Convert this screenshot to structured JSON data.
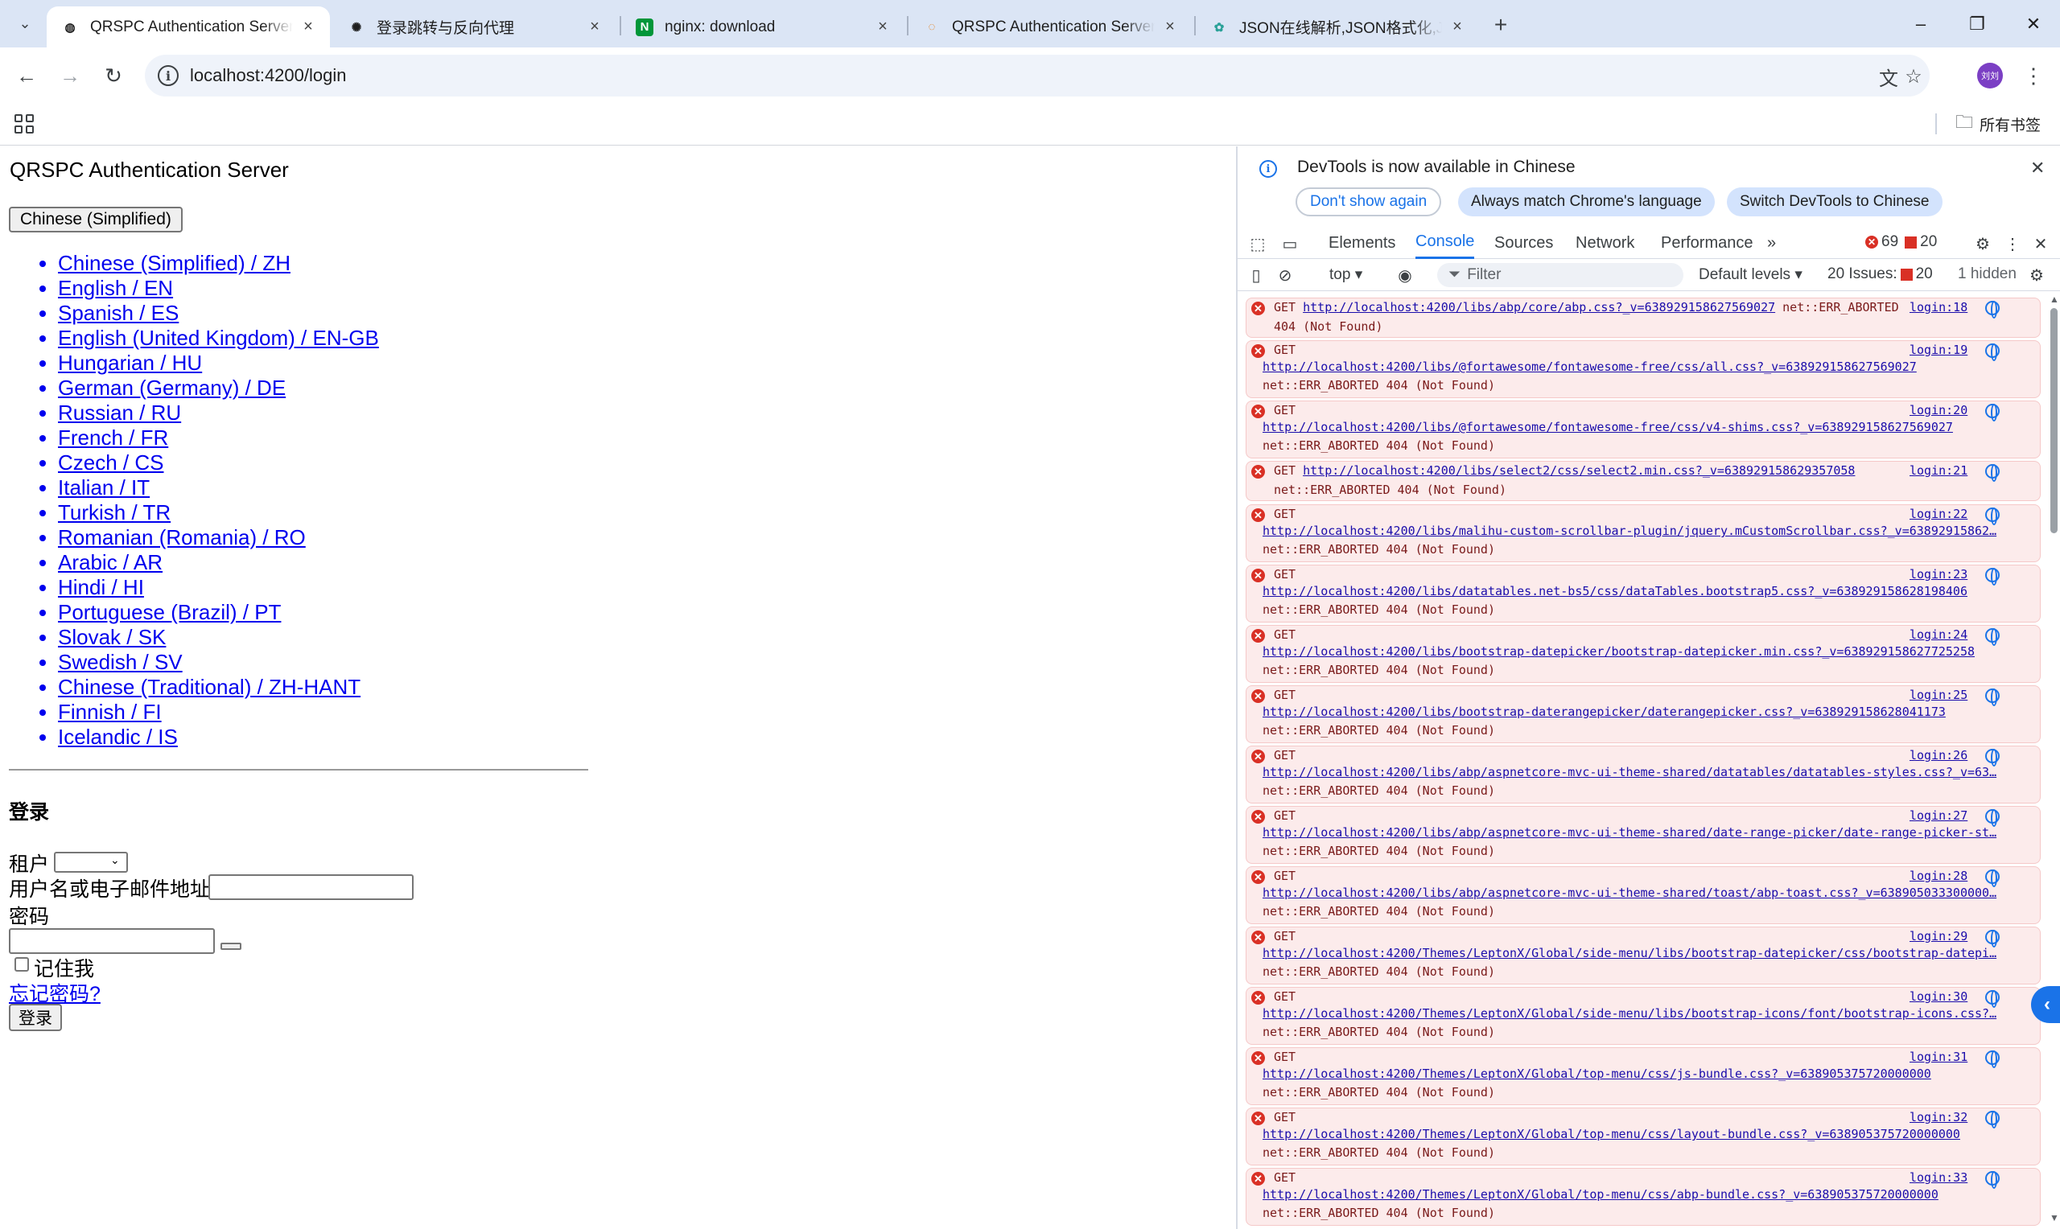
{
  "browser": {
    "tabs": [
      {
        "title": "QRSPC Authentication Server",
        "favicon": "globe-icon",
        "close": "×"
      },
      {
        "title": "登录跳转与反向代理",
        "favicon": "openai-icon",
        "close": "×"
      },
      {
        "title": "nginx: download",
        "favicon": "nginx-icon",
        "close": "×"
      },
      {
        "title": "QRSPC Authentication Server",
        "favicon": "loading-icon",
        "close": "×"
      },
      {
        "title": "JSON在线解析,JSON格式化,JS",
        "favicon": "json-icon",
        "close": "×"
      }
    ],
    "new_tab": "+",
    "window_controls": {
      "minimize": "–",
      "restore": "❐",
      "close": "✕"
    },
    "nav": {
      "back": "←",
      "forward": "→",
      "reload": "↻"
    },
    "url": "localhost:4200/login",
    "avatar_text": "刘刘",
    "bookmarks_all": "所有书签"
  },
  "page": {
    "title": "QRSPC Authentication Server",
    "language_button": "Chinese (Simplified)",
    "languages": [
      "Chinese (Simplified) / ZH",
      "English / EN",
      "Spanish / ES",
      "English (United Kingdom) / EN-GB",
      "Hungarian / HU",
      "German (Germany) / DE",
      "Russian / RU",
      "French / FR",
      "Czech / CS",
      "Italian / IT",
      "Turkish / TR",
      "Romanian (Romania) / RO",
      "Arabic / AR",
      "Hindi / HI",
      "Portuguese (Brazil) / PT",
      "Slovak / SK",
      "Swedish / SV",
      "Chinese (Traditional) / ZH-HANT",
      "Finnish / FI",
      "Icelandic / IS"
    ],
    "login_heading": "登录",
    "tenant_label": "租户",
    "username_label": "用户名或电子邮件地址",
    "password_label": "密码",
    "remember_label": "记住我",
    "forgot_link": "忘记密码?",
    "login_button": "登录"
  },
  "devtools": {
    "banner_text": "DevTools is now available in Chinese",
    "btn_dont_show": "Don't show again",
    "btn_always_match": "Always match Chrome's language",
    "btn_switch": "Switch DevTools to Chinese",
    "tabs": [
      "Elements",
      "Console",
      "Sources",
      "Network",
      "Performance"
    ],
    "more_tabs": "»",
    "error_count": "69",
    "issue_count": "20",
    "context": "top ▾",
    "filter_placeholder": "Filter",
    "levels": "Default levels ▾",
    "issues_label": "20 Issues:",
    "issues_count": "20",
    "hidden_label": "1 hidden",
    "messages": [
      {
        "line1": "GET",
        "url": "http://localhost:4200/libs/abp/core/abp.css?_v=638929158627569027",
        "inline_tail": "net::ERR_ABORTED",
        "line2": "404 (Not Found)",
        "src": "login:18"
      },
      {
        "line1": "GET",
        "url": "http://localhost:4200/libs/@fortawesome/fontawesome-free/css/all.css?_v=638929158627569027",
        "line2": "net::ERR_ABORTED 404 (Not Found)",
        "src": "login:19"
      },
      {
        "line1": "GET",
        "url": "http://localhost:4200/libs/@fortawesome/fontawesome-free/css/v4-shims.css?_v=638929158627569027",
        "line2": "net::ERR_ABORTED 404 (Not Found)",
        "src": "login:20"
      },
      {
        "line1": "GET",
        "url": "http://localhost:4200/libs/select2/css/select2.min.css?_v=638929158629357058",
        "line2": "net::ERR_ABORTED 404 (Not Found)",
        "src": "login:21"
      },
      {
        "line1": "GET",
        "url": "http://localhost:4200/libs/malihu-custom-scrollbar-plugin/jquery.mCustomScrollbar.css?_v=63892915862…",
        "line2": "net::ERR_ABORTED 404 (Not Found)",
        "src": "login:22"
      },
      {
        "line1": "GET",
        "url": "http://localhost:4200/libs/datatables.net-bs5/css/dataTables.bootstrap5.css?_v=638929158628198406",
        "line2": "net::ERR_ABORTED 404 (Not Found)",
        "src": "login:23"
      },
      {
        "line1": "GET",
        "url": "http://localhost:4200/libs/bootstrap-datepicker/bootstrap-datepicker.min.css?_v=638929158627725258",
        "line2": "net::ERR_ABORTED 404 (Not Found)",
        "src": "login:24"
      },
      {
        "line1": "GET",
        "url": "http://localhost:4200/libs/bootstrap-daterangepicker/daterangepicker.css?_v=638929158628041173",
        "line2": "net::ERR_ABORTED 404 (Not Found)",
        "src": "login:25"
      },
      {
        "line1": "GET",
        "url": "http://localhost:4200/libs/abp/aspnetcore-mvc-ui-theme-shared/datatables/datatables-styles.css?_v=63…",
        "line2": "net::ERR_ABORTED 404 (Not Found)",
        "src": "login:26"
      },
      {
        "line1": "GET",
        "url": "http://localhost:4200/libs/abp/aspnetcore-mvc-ui-theme-shared/date-range-picker/date-range-picker-st…",
        "line2": "net::ERR_ABORTED 404 (Not Found)",
        "src": "login:27"
      },
      {
        "line1": "GET",
        "url": "http://localhost:4200/libs/abp/aspnetcore-mvc-ui-theme-shared/toast/abp-toast.css?_v=638905033300000…",
        "line2": "net::ERR_ABORTED 404 (Not Found)",
        "src": "login:28"
      },
      {
        "line1": "GET",
        "url": "http://localhost:4200/Themes/LeptonX/Global/side-menu/libs/bootstrap-datepicker/css/bootstrap-datepi…",
        "line2": "net::ERR_ABORTED 404 (Not Found)",
        "src": "login:29"
      },
      {
        "line1": "GET",
        "url": "http://localhost:4200/Themes/LeptonX/Global/side-menu/libs/bootstrap-icons/font/bootstrap-icons.css?…",
        "line2": "net::ERR_ABORTED 404 (Not Found)",
        "src": "login:30"
      },
      {
        "line1": "GET",
        "url": "http://localhost:4200/Themes/LeptonX/Global/top-menu/css/js-bundle.css?_v=638905375720000000",
        "line2": "net::ERR_ABORTED 404 (Not Found)",
        "src": "login:31"
      },
      {
        "line1": "GET",
        "url": "http://localhost:4200/Themes/LeptonX/Global/top-menu/css/layout-bundle.css?_v=638905375720000000",
        "line2": "net::ERR_ABORTED 404 (Not Found)",
        "src": "login:32"
      },
      {
        "line1": "GET",
        "url": "http://localhost:4200/Themes/LeptonX/Global/top-menu/css/abp-bundle.css?_v=638905375720000000",
        "line2": "net::ERR_ABORTED 404 (Not Found)",
        "src": "login:33"
      }
    ]
  }
}
